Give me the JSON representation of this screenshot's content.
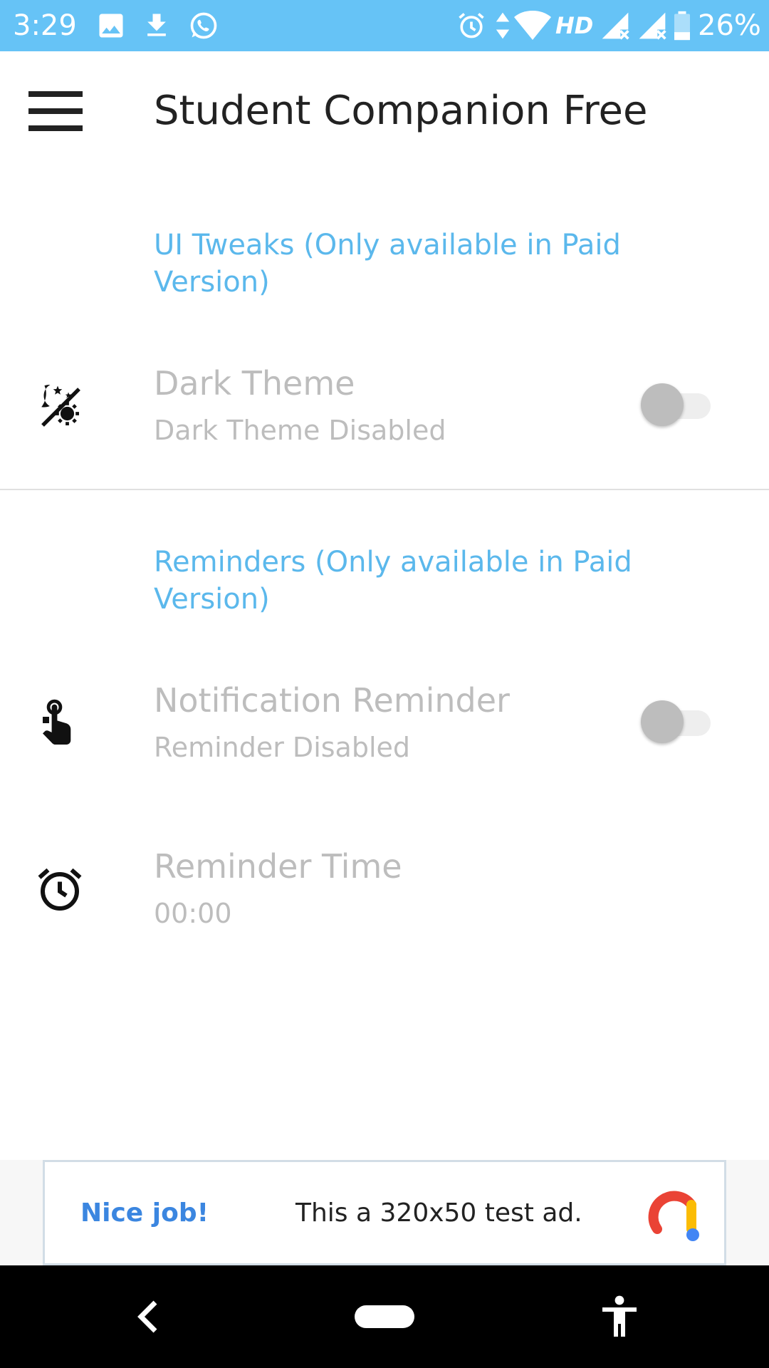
{
  "status_bar": {
    "time": "3:29",
    "network_label": "HD",
    "battery_percent": "26%",
    "icons": [
      "image-icon",
      "download-icon",
      "whatsapp-icon",
      "alarm-icon",
      "data-arrows-icon",
      "wifi-icon",
      "signal-icon",
      "signal-icon",
      "battery-icon"
    ],
    "background_color": "#66c3f6"
  },
  "app_bar": {
    "title": "Student Companion Free",
    "menu_icon": "hamburger-menu-icon"
  },
  "sections": [
    {
      "header": "UI Tweaks (Only available in Paid Version)",
      "items": [
        {
          "title": "Dark Theme",
          "summary": "Dark Theme Disabled",
          "icon": "theme-light-dark-icon",
          "switch_on": false
        }
      ]
    },
    {
      "header": "Reminders (Only available in Paid Version)",
      "items": [
        {
          "title": "Notification Reminder",
          "summary": "Reminder Disabled",
          "icon": "gesture-tap-icon",
          "switch_on": false
        },
        {
          "title": "Reminder Time",
          "summary": "00:00",
          "icon": "alarm-clock-icon"
        }
      ]
    }
  ],
  "ad": {
    "label": "Nice job!",
    "text": "This a 320x50 test ad.",
    "logo": "ads-logo-icon"
  },
  "nav_bar": {
    "buttons": [
      "back-icon",
      "home-pill-icon",
      "accessibility-icon"
    ]
  },
  "colors": {
    "accent": "#5bb8ec",
    "disabled_text": "#bdbdbd",
    "title_text": "#222222"
  }
}
